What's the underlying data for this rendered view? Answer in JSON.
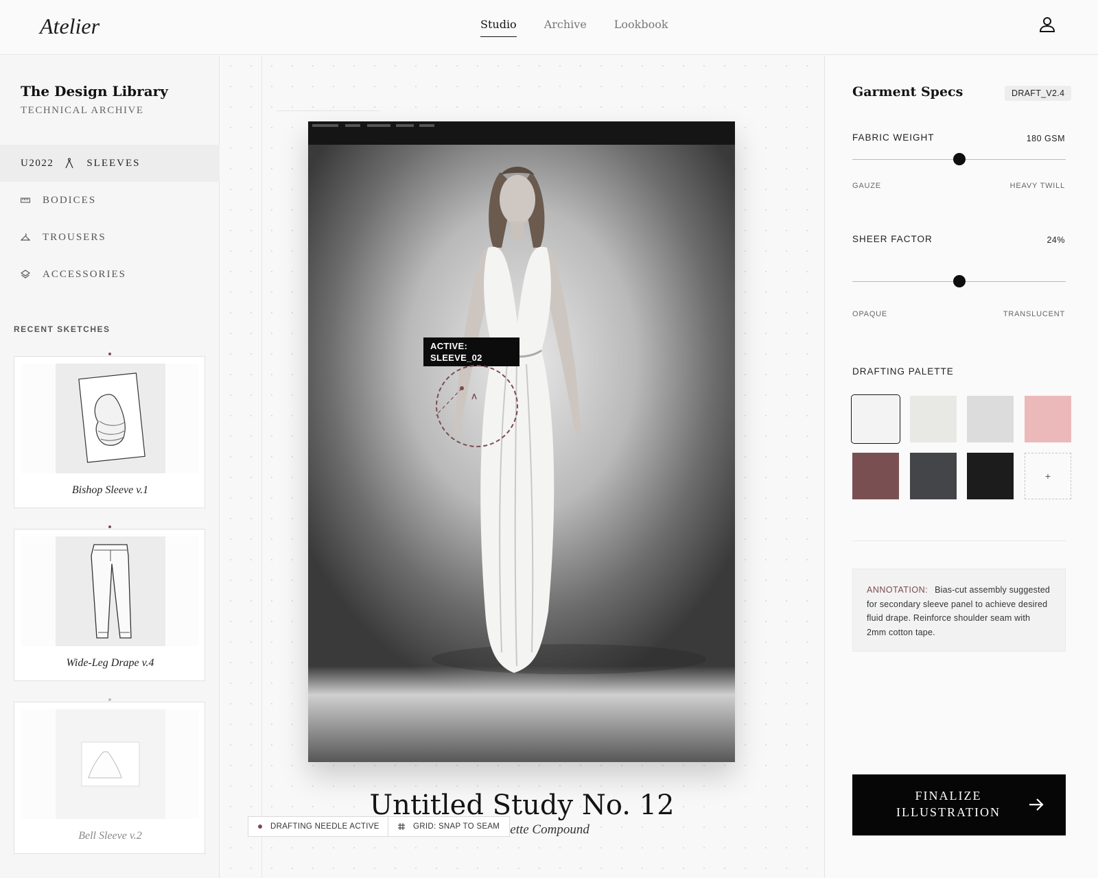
{
  "app": {
    "brand": "Atelier"
  },
  "nav": {
    "items": [
      "Studio",
      "Archive",
      "Lookbook"
    ],
    "active": "Studio"
  },
  "sidebar": {
    "title": "The Design Library",
    "subtitle": "TECHNICAL ARCHIVE",
    "categories": [
      {
        "code": "U2022",
        "label": "SLEEVES",
        "icon": "compass-icon",
        "active": true
      },
      {
        "label": "BODICES",
        "icon": "ruler-icon"
      },
      {
        "label": "TROUSERS",
        "icon": "hanger-icon"
      },
      {
        "label": "ACCESSORIES",
        "icon": "layers-icon"
      }
    ],
    "recent_label": "RECENT SKETCHES",
    "recent_sketches": [
      {
        "name": "Bishop Sleeve v.1"
      },
      {
        "name": "Wide-Leg Drape v.4"
      },
      {
        "name": "Bell Sleeve v.2"
      }
    ]
  },
  "canvas": {
    "active_tag": "ACTIVE:\nSLEEVE_02",
    "study_title": "Untitled Study No. 12",
    "study_subtitle": "Silk Georgette Compound",
    "chips": {
      "needle": "DRAFTING NEEDLE ACTIVE",
      "grid": "GRID: SNAP TO SEAM"
    }
  },
  "specs": {
    "title": "Garment Specs",
    "badge": "DRAFT_V2.4",
    "fabric_weight": {
      "label": "FABRIC WEIGHT",
      "value": "180 GSM",
      "min_label": "GAUZE",
      "max_label": "HEAVY TWILL",
      "level": 0.5
    },
    "sheer_factor": {
      "label": "SHEER FACTOR",
      "value": "24%",
      "min_label": "OPAQUE",
      "max_label": "TRANSLUCENT",
      "level": 0.5
    },
    "palette_label": "DRAFTING PALETTE",
    "palette": [
      "#f3f3f3",
      "#e8e8e5",
      "#dcdcdc",
      "#ecb9ba",
      "#7a4f52",
      "#444548",
      "#1c1c1c"
    ],
    "palette_add": "+",
    "annotation": {
      "key": "ANNOTATION:",
      "text": "Bias-cut assembly suggested for secondary sleeve panel to achieve desired fluid drape. Reinforce shoulder seam with 2mm cotton tape."
    },
    "finalize_label": "FINALIZE\nILLUSTRATION"
  },
  "colors": {
    "accent": "#7a4b52",
    "primary": "#060606"
  }
}
